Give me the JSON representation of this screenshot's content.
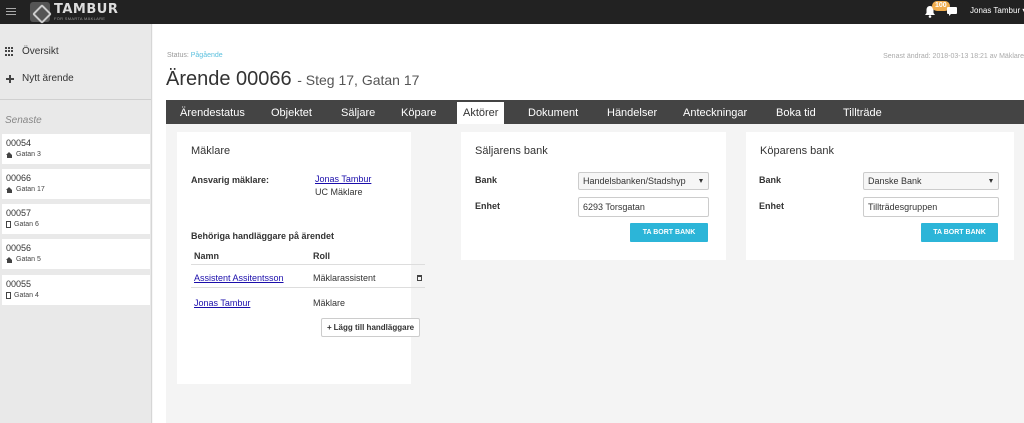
{
  "brand": {
    "name": "TAMBUR",
    "tagline": "FÖR SMARTA MÄKLARE"
  },
  "topbar": {
    "notification_count": "100",
    "user_name": "Jonas Tambur"
  },
  "sidebar": {
    "items": [
      {
        "label": "Översikt",
        "icon": "grid-icon"
      },
      {
        "label": "Nytt ärende",
        "icon": "plus-icon"
      }
    ],
    "recent_heading": "Senaste",
    "recent": [
      {
        "number": "00054",
        "address": "Gatan 3",
        "icon": "home-icon"
      },
      {
        "number": "00066",
        "address": "Gatan 17",
        "icon": "home-icon"
      },
      {
        "number": "00057",
        "address": "Gatan 6",
        "icon": "building-icon"
      },
      {
        "number": "00056",
        "address": "Gatan 5",
        "icon": "home-icon"
      },
      {
        "number": "00055",
        "address": "Gatan 4",
        "icon": "building-icon"
      }
    ]
  },
  "header": {
    "status_label": "Status:",
    "status_value": "Pågående",
    "last_changed": "Senast ändrad: 2018-03-13 18:21 av Mäklare",
    "title": "Ärende 00066",
    "subtitle": "- Steg 17, Gatan 17"
  },
  "tabs": [
    {
      "label": "Ärendestatus",
      "active": false
    },
    {
      "label": "Objektet",
      "active": false
    },
    {
      "label": "Säljare",
      "active": false
    },
    {
      "label": "Köpare",
      "active": false
    },
    {
      "label": "Aktörer",
      "active": true
    },
    {
      "label": "Dokument",
      "active": false
    },
    {
      "label": "Händelser",
      "active": false
    },
    {
      "label": "Anteckningar",
      "active": false
    },
    {
      "label": "Boka tid",
      "active": false
    },
    {
      "label": "Tillträde",
      "active": false
    }
  ],
  "makler": {
    "title": "Mäklare",
    "responsible_label": "Ansvarig mäklare:",
    "responsible_name": "Jonas Tambur",
    "responsible_office": "UC Mäklare",
    "handlers_heading": "Behöriga handläggare på ärendet",
    "columns": [
      "Namn",
      "Roll"
    ],
    "rows": [
      {
        "name": "Assistent Assitentsson",
        "role": "Mäklarassistent"
      },
      {
        "name": "Jonas Tambur",
        "role": "Mäklare"
      }
    ],
    "add_button": "Lägg till handläggare"
  },
  "seller_bank": {
    "title": "Säljarens bank",
    "bank_label": "Bank",
    "bank_value": "Handelsbanken/Stadshyp",
    "unit_label": "Enhet",
    "unit_value": "6293 Torsgatan",
    "remove_button": "TA BORT BANK"
  },
  "buyer_bank": {
    "title": "Köparens bank",
    "bank_label": "Bank",
    "bank_value": "Danske Bank",
    "unit_label": "Enhet",
    "unit_value": "Tillträdesgruppen",
    "remove_button": "TA BORT BANK"
  },
  "colors": {
    "topbar": "#222222",
    "accent": "#2cb5d8",
    "badge": "#f0ad4e",
    "tabbar": "#444444",
    "status": "#5bc0de"
  }
}
